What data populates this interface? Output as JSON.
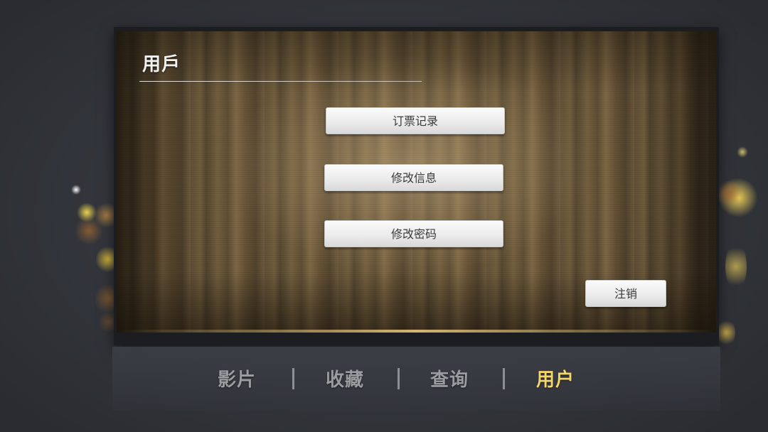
{
  "panel": {
    "title": "用戶"
  },
  "actions": {
    "bookings_label": "订票记录",
    "edit_info_label": "修改信息",
    "change_password_label": "修改密码",
    "logout_label": "注销"
  },
  "nav": {
    "items": [
      {
        "label": "影片",
        "active": false
      },
      {
        "label": "收藏",
        "active": false
      },
      {
        "label": "查询",
        "active": false
      },
      {
        "label": "用户",
        "active": true
      }
    ]
  },
  "colors": {
    "active_nav": "#f3d66a",
    "inactive_nav": "#9a9ca0",
    "background": "#33363c"
  }
}
